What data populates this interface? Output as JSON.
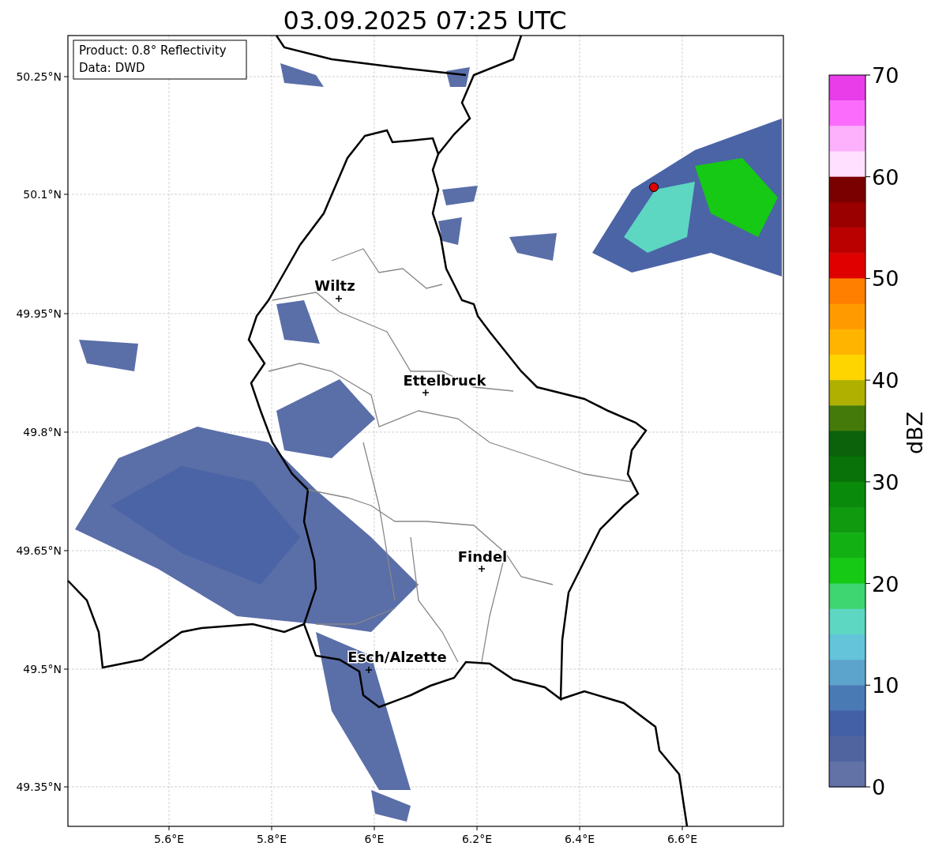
{
  "title": "03.09.2025 07:25 UTC",
  "info_box": [
    "Product: 0.8° Reflectivity",
    "Data: DWD"
  ],
  "y_ticks": [
    "50.25°N",
    "50.1°N",
    "49.95°N",
    "49.8°N",
    "49.65°N",
    "49.5°N",
    "49.35°N"
  ],
  "x_ticks": [
    "5.6°E",
    "5.8°E",
    "6°E",
    "6.2°E",
    "6.4°E",
    "6.6°E"
  ],
  "cities": [
    {
      "name": "Wiltz"
    },
    {
      "name": "Ettelbruck"
    },
    {
      "name": "Findel"
    },
    {
      "name": "Esch/Alzette"
    }
  ],
  "colorbar": {
    "label": "dBZ",
    "tick_labels": [
      "70",
      "60",
      "50",
      "40",
      "30",
      "20",
      "10",
      "0"
    ],
    "bands": [
      {
        "color": "#e83de8"
      },
      {
        "color": "#fc6cfc"
      },
      {
        "color": "#fdb1fd"
      },
      {
        "color": "#ffe0ff"
      },
      {
        "color": "#7a0000"
      },
      {
        "color": "#9a0000"
      },
      {
        "color": "#bb0000"
      },
      {
        "color": "#e00000"
      },
      {
        "color": "#ff7f00"
      },
      {
        "color": "#ff9b00"
      },
      {
        "color": "#ffb500"
      },
      {
        "color": "#ffd500"
      },
      {
        "color": "#b0b000"
      },
      {
        "color": "#447a0a"
      },
      {
        "color": "#0b620b"
      },
      {
        "color": "#097209"
      },
      {
        "color": "#0a8a0a"
      },
      {
        "color": "#0f9a0f"
      },
      {
        "color": "#13b013"
      },
      {
        "color": "#15c915"
      },
      {
        "color": "#3ed670"
      },
      {
        "color": "#5dd6c2"
      },
      {
        "color": "#63c4da"
      },
      {
        "color": "#5ca4cc"
      },
      {
        "color": "#4a7ab4"
      },
      {
        "color": "#4360a6"
      },
      {
        "color": "#5065a0"
      },
      {
        "color": "#6271a6"
      }
    ]
  }
}
